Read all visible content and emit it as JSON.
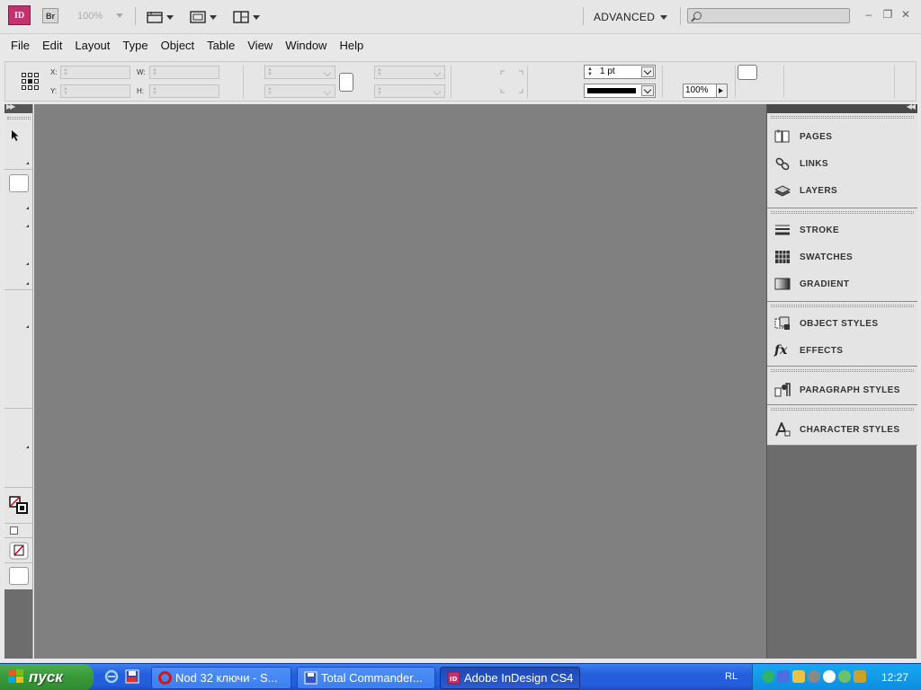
{
  "app": {
    "logo": "ID",
    "bridge": "Br",
    "zoom": "100%",
    "workspace": "ADVANCED",
    "search_placeholder": ""
  },
  "menu": [
    "File",
    "Edit",
    "Layout",
    "Type",
    "Object",
    "Table",
    "View",
    "Window",
    "Help"
  ],
  "control_bar": {
    "x_label": "X:",
    "y_label": "Y:",
    "w_label": "W:",
    "h_label": "H:",
    "stroke_weight": "1 pt",
    "opacity": "100%"
  },
  "panels": [
    {
      "label": "PAGES",
      "icon": "pages-icon"
    },
    {
      "label": "LINKS",
      "icon": "links-icon"
    },
    {
      "label": "LAYERS",
      "icon": "layers-icon"
    },
    {
      "label": "STROKE",
      "icon": "stroke-icon"
    },
    {
      "label": "SWATCHES",
      "icon": "swatches-icon"
    },
    {
      "label": "GRADIENT",
      "icon": "gradient-icon"
    },
    {
      "label": "OBJECT STYLES",
      "icon": "object-styles-icon"
    },
    {
      "label": "EFFECTS",
      "icon": "effects-icon"
    },
    {
      "label": "PARAGRAPH STYLES",
      "icon": "paragraph-styles-icon"
    },
    {
      "label": "CHARACTER STYLES",
      "icon": "character-styles-icon"
    }
  ],
  "effects_glyph": "fx",
  "taskbar": {
    "start": "пуск",
    "tasks": [
      {
        "label": "Nod 32 ключи - S...",
        "active": false
      },
      {
        "label": "Total Commander...",
        "active": false
      },
      {
        "label": "Adobe InDesign CS4",
        "active": true
      }
    ],
    "lang": "RL",
    "clock": "12:27"
  },
  "colors": {
    "indesign_brand": "#c4316f",
    "canvas": "#808080",
    "taskbar_blue": "#245edc",
    "start_green": "#3a9a3a"
  }
}
